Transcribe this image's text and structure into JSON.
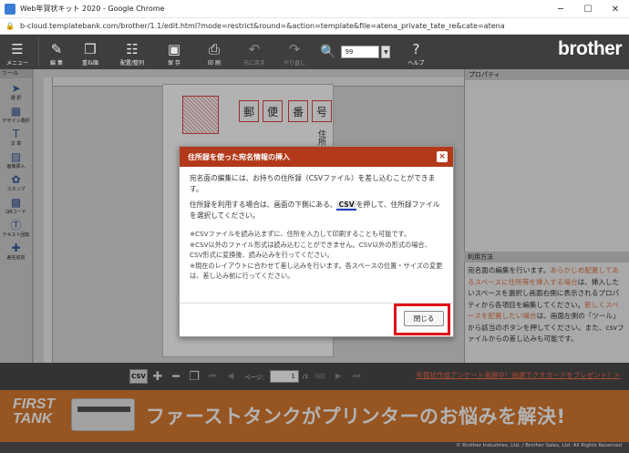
{
  "window": {
    "title": "Web年賀状キット 2020 - Google Chrome",
    "url": "b-cloud.templatebank.com/brother/1.1/edit.html?mode=restrict&round=&action=template&file=atena_private_tate_re&cate=atena",
    "controls": [
      "─",
      "☐",
      "✕"
    ]
  },
  "toolbar": {
    "menu": "メニュー",
    "edit": "編 集",
    "layer": "重ね順",
    "arrange": "配置/整列",
    "save": "保 存",
    "print": "印 刷",
    "undo": "元に戻す",
    "redo": "やり直し",
    "zoom_value": "99",
    "help": "ヘルプ",
    "brand": "brother"
  },
  "tools": {
    "header": "ツール",
    "items": [
      "選 択",
      "デザイン選択",
      "文 章",
      "画像挿入",
      "スタンプ",
      "QRコード",
      "テキスト回転",
      "差名追加"
    ]
  },
  "canvas": {
    "zip_chars": [
      "郵",
      "便",
      "番",
      "号"
    ],
    "address_vertical": "住所"
  },
  "properties": {
    "header": "プロパティ"
  },
  "help": {
    "header": "利用方法",
    "segments": [
      {
        "text": "宛名面の編集を行います。",
        "hl": false
      },
      {
        "text": "あらかじめ配置してあるスペースに住所等を挿入する場合",
        "hl": true
      },
      {
        "text": "は、挿入したいスペースを選択し画面右側に表示されるプロパティから各項目を編集してください。",
        "hl": false
      },
      {
        "text": "新しくスペースを配置したい場合",
        "hl": true
      },
      {
        "text": "は、画面左側の「ツール」から該当のボタンを押してください。また、csvファイルからの差し込みも可能です。",
        "hl": false
      }
    ]
  },
  "pager": {
    "csv": "CSV",
    "page_label": "ページ：",
    "page_value": "1",
    "page_total": "/1",
    "go": "GO",
    "survey_link": "年賀状作成アンケート実施中！抽選でクオカードをプレゼント！>"
  },
  "banner": {
    "brand_line1": "FIRST",
    "brand_line2": "TANK",
    "message": "ファーストタンクがプリンターのお悩みを解決!"
  },
  "footer": {
    "copyright": "© Brother Industries, Ltd. / Brother Sales, Ltd. All Rights Reserved"
  },
  "modal": {
    "title": "住所録を使った宛名情報の挿入",
    "close_x": "×",
    "para1": "宛名面の編集には、お持ちの住所録（CSVファイル）を差し込むことができます。",
    "para2_before": "住所録を利用する場合は、画面の下側にある、",
    "para2_csv": "CSV",
    "para2_after": "を押して、住所録ファイルを選択してください。",
    "note1": "※CSVファイルを読み込まずに、住所を入力して印刷することも可能です。",
    "note2": "※CSV以外のファイル形式は読み込むことができません。CSV以外の形式の場合、CSV形式に変換後、読み込みを行ってください。",
    "note3": "※現在のレイアウトに合わせて差し込みを行います。各スペースの位置・サイズの変更は、差し込み前に行ってください。",
    "close_button": "閉じる"
  }
}
